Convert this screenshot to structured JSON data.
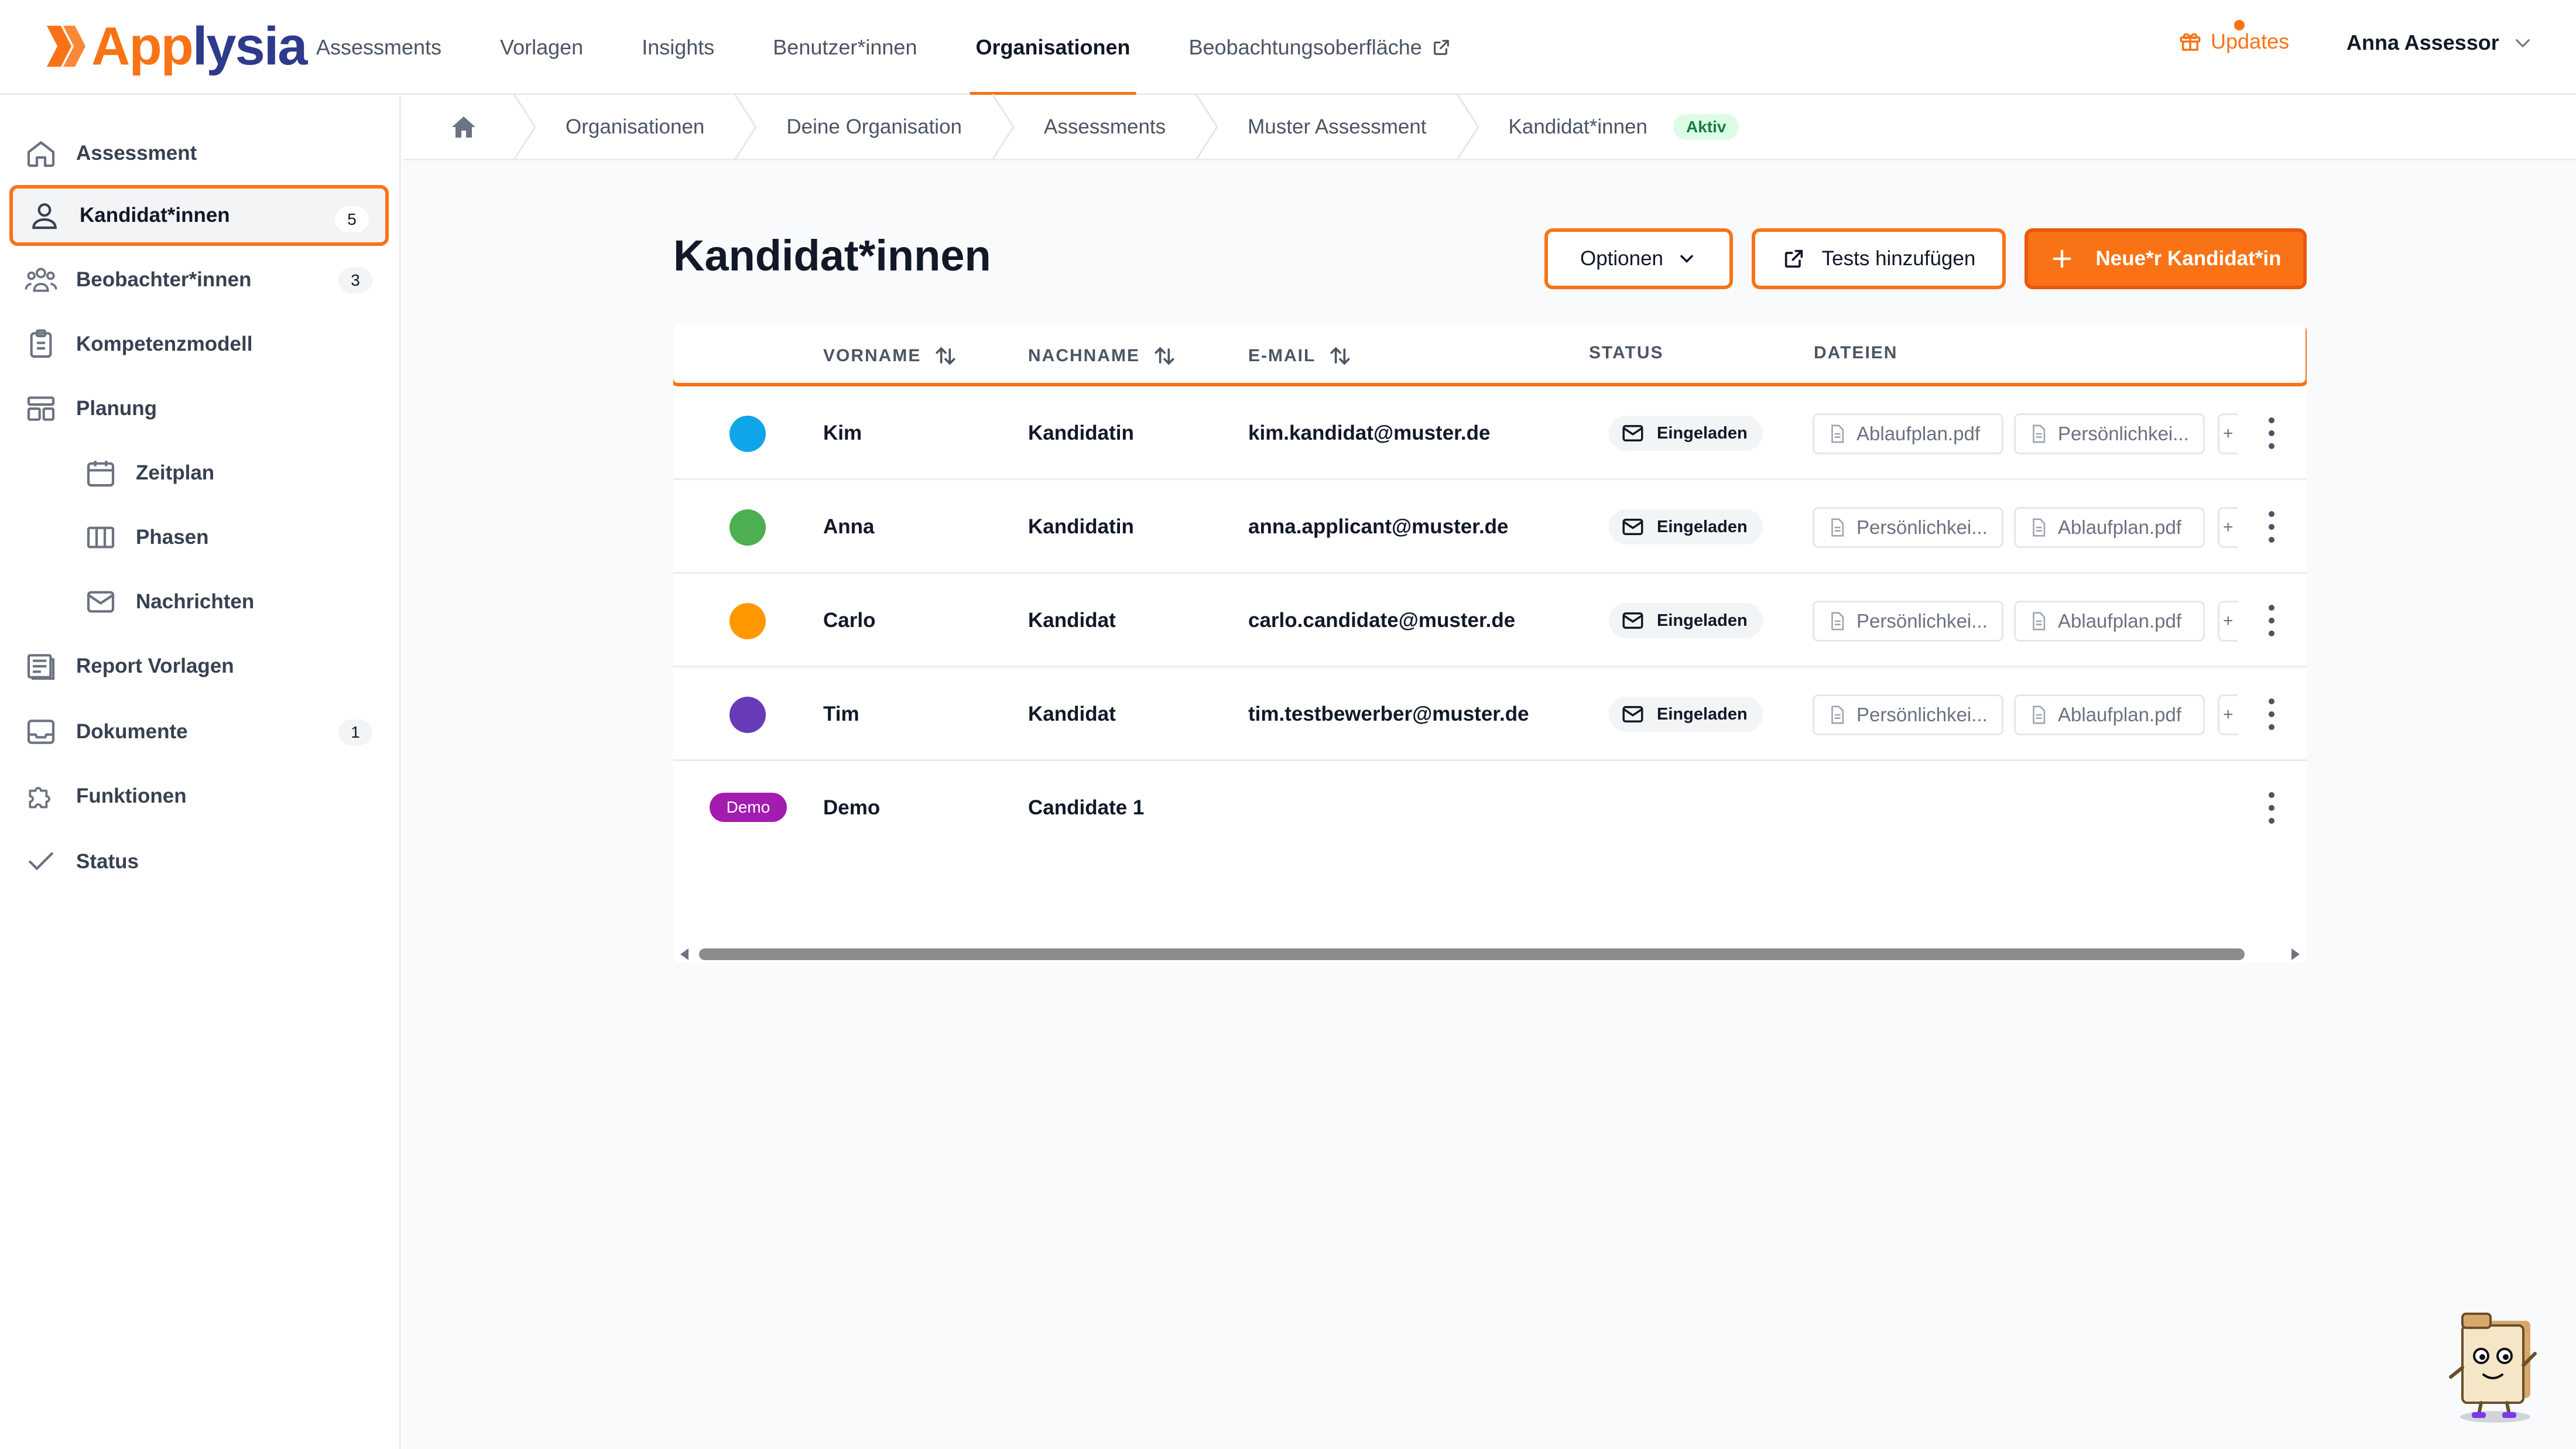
{
  "app": {
    "logo_prefix": "App",
    "logo_suffix": "lysia",
    "brand_color": "#f97316",
    "brand_secondary": "#2e3a8c"
  },
  "nav": {
    "items": [
      "Assessments",
      "Vorlagen",
      "Insights",
      "Benutzer*innen",
      "Organisationen",
      "Beobachtungsoberfläche"
    ],
    "active": "Organisationen",
    "updates_label": "Updates",
    "user_name": "Anna Assessor"
  },
  "sidebar": {
    "items": [
      {
        "label": "Assessment",
        "icon": "home-icon"
      },
      {
        "label": "Kandidat*innen",
        "icon": "user-icon",
        "count": "5",
        "active": true
      },
      {
        "label": "Beobachter*innen",
        "icon": "users-group-icon",
        "count": "3"
      },
      {
        "label": "Kompetenzmodell",
        "icon": "clipboard-icon"
      },
      {
        "label": "Planung",
        "icon": "layout-icon"
      },
      {
        "label": "Zeitplan",
        "icon": "calendar-icon",
        "sub": true
      },
      {
        "label": "Phasen",
        "icon": "columns-icon",
        "sub": true
      },
      {
        "label": "Nachrichten",
        "icon": "mail-icon",
        "sub": true
      },
      {
        "label": "Report Vorlagen",
        "icon": "report-icon"
      },
      {
        "label": "Dokumente",
        "icon": "inbox-icon",
        "count": "1"
      },
      {
        "label": "Funktionen",
        "icon": "puzzle-icon"
      },
      {
        "label": "Status",
        "icon": "check-icon"
      }
    ]
  },
  "breadcrumb": {
    "items": [
      "Organisationen",
      "Deine Organisation",
      "Assessments",
      "Muster Assessment",
      "Kandidat*innen"
    ],
    "status_badge": "Aktiv"
  },
  "page": {
    "title": "Kandidat*innen",
    "options_button": "Optionen",
    "tests_button": "Tests hinzufügen",
    "new_button": "Neue*r Kandidat*in"
  },
  "table": {
    "headers": {
      "vorname": "VORNAME",
      "nachname": "NACHNAME",
      "email": "E-MAIL",
      "status": "STATUS",
      "dateien": "DATEIEN"
    },
    "rows": [
      {
        "color": "#0ea5e9",
        "vorname": "Kim",
        "nachname": "Kandidatin",
        "email": "kim.kandidat@muster.de",
        "status": "Eingeladen",
        "files": [
          "Ablaufplan.pdf",
          "Persönlichkei..."
        ]
      },
      {
        "color": "#4caf50",
        "vorname": "Anna",
        "nachname": "Kandidatin",
        "email": "anna.applicant@muster.de",
        "status": "Eingeladen",
        "files": [
          "Persönlichkei...",
          "Ablaufplan.pdf"
        ]
      },
      {
        "color": "#ff9800",
        "vorname": "Carlo",
        "nachname": "Kandidat",
        "email": "carlo.candidate@muster.de",
        "status": "Eingeladen",
        "files": [
          "Persönlichkei...",
          "Ablaufplan.pdf"
        ]
      },
      {
        "color": "#673ab7",
        "vorname": "Tim",
        "nachname": "Kandidat",
        "email": "tim.testbewerber@muster.de",
        "status": "Eingeladen",
        "files": [
          "Persönlichkei...",
          "Ablaufplan.pdf"
        ]
      }
    ],
    "demo_row": {
      "badge": "Demo",
      "vorname": "Demo",
      "nachname": "Candidate 1"
    }
  }
}
